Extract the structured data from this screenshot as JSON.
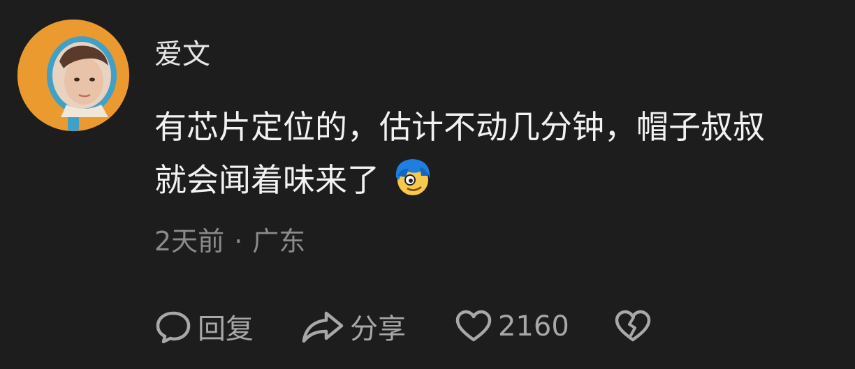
{
  "comment": {
    "user": {
      "name": "爱文",
      "avatar_icon": "avatar-photo-mirror"
    },
    "text_lines": [
      "有芯片定位的，估计不动几分钟，帽子叔叔",
      "就会闻着味来了"
    ],
    "emoji": "blue-hair-face-emoji",
    "meta": {
      "time": "2天前",
      "separator": "·",
      "location": "广东"
    },
    "actions": {
      "reply_label": "回复",
      "share_label": "分享",
      "like_count": "2160",
      "dislike_icon": "broken-heart-icon"
    }
  },
  "colors": {
    "background": "#1e1d1d",
    "text": "#f2f2f2",
    "meta": "#8c8b8b",
    "action": "#a9a8a8",
    "avatar_bg": "#ea9a2f"
  }
}
